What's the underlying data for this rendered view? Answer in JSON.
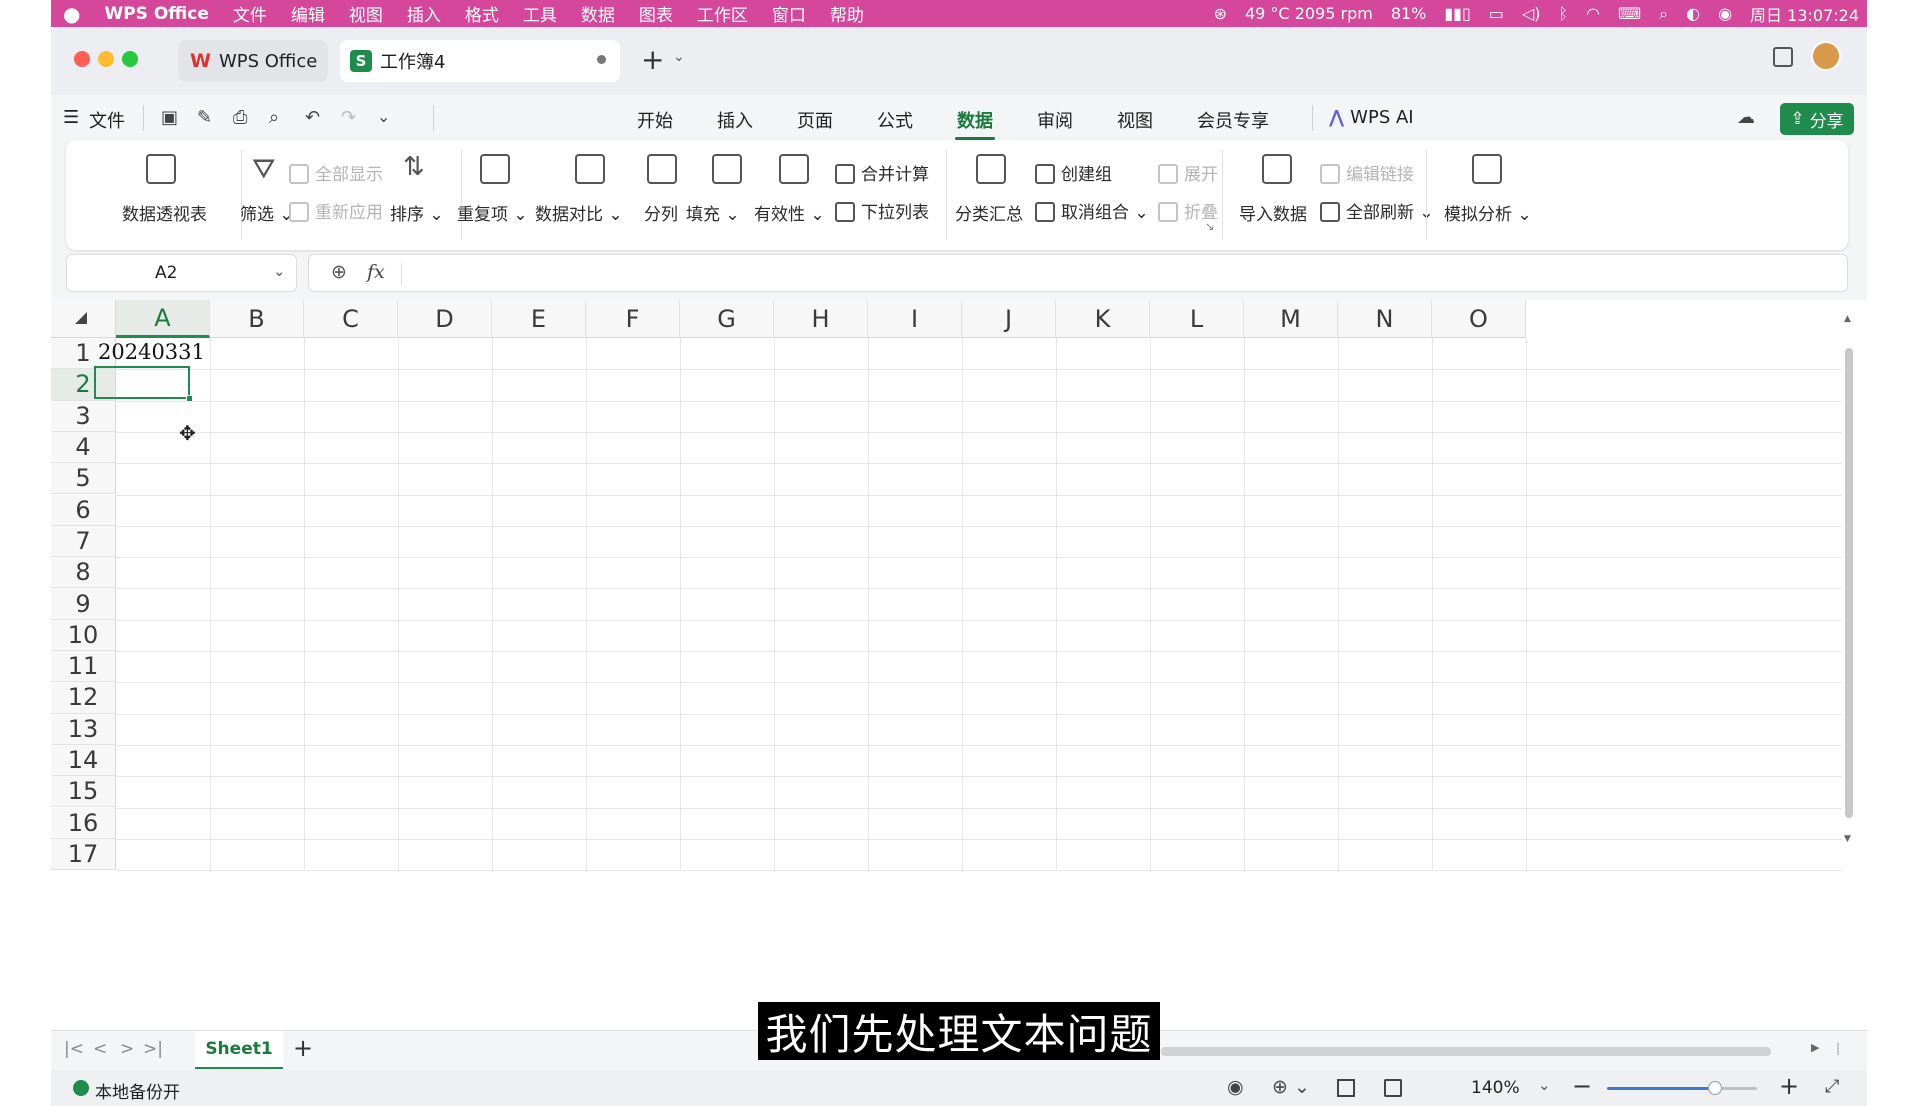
{
  "mac_menubar": {
    "apple": "",
    "app": "WPS Office",
    "items": [
      "文件",
      "编辑",
      "视图",
      "插入",
      "格式",
      "工具",
      "数据",
      "图表",
      "工作区",
      "窗口",
      "帮助"
    ],
    "sensor": "49 °C 2095 rpm",
    "battery": "81%",
    "clock": "周日 13:07:24"
  },
  "titlebar": {
    "tab_home": "WPS Office",
    "tab_doc": "工作簿4",
    "new_tab": "+"
  },
  "menu": {
    "file": "文件",
    "ribbon_tabs": [
      "开始",
      "插入",
      "页面",
      "公式",
      "数据",
      "审阅",
      "视图",
      "会员专享"
    ],
    "active_tab_index": 4,
    "wps_ai": "WPS AI",
    "share": "分享"
  },
  "ribbon": {
    "pivot": "数据透视表",
    "filter": "筛选",
    "show_all": "全部显示",
    "reapply": "重新应用",
    "sort": "排序",
    "duplicates": "重复项",
    "compare": "数据对比",
    "split": "分列",
    "fill": "填充",
    "validity": "有效性",
    "merge_calc": "合并计算",
    "dropdown_list": "下拉列表",
    "subtotal": "分类汇总",
    "group": "创建组",
    "ungroup": "取消组合",
    "expand": "展开",
    "collapse": "折叠",
    "import": "导入数据",
    "edit_links": "编辑链接",
    "refresh_all": "全部刷新",
    "whatif": "模拟分析"
  },
  "formula_bar": {
    "name_box": "A2",
    "fx": "fx",
    "content": ""
  },
  "sheet": {
    "columns": [
      "A",
      "B",
      "C",
      "D",
      "E",
      "F",
      "G",
      "H",
      "I",
      "J",
      "K",
      "L",
      "M",
      "N",
      "O"
    ],
    "rows": [
      "1",
      "2",
      "3",
      "4",
      "5",
      "6",
      "7",
      "8",
      "9",
      "10",
      "11",
      "12",
      "13",
      "14",
      "15",
      "16",
      "17"
    ],
    "cells": {
      "A1": "20240331"
    },
    "selected": "A2"
  },
  "sheet_tabs": {
    "active": "Sheet1",
    "add": "+"
  },
  "status": {
    "backup": "本地备份开",
    "zoom": "140%",
    "zoom_level": 0.72
  },
  "subtitle": "我们先处理文本问题",
  "colors": {
    "menubar": "#d4479a",
    "accent_green": "#1f8b4c",
    "active_tab": "#1b7a3e"
  }
}
